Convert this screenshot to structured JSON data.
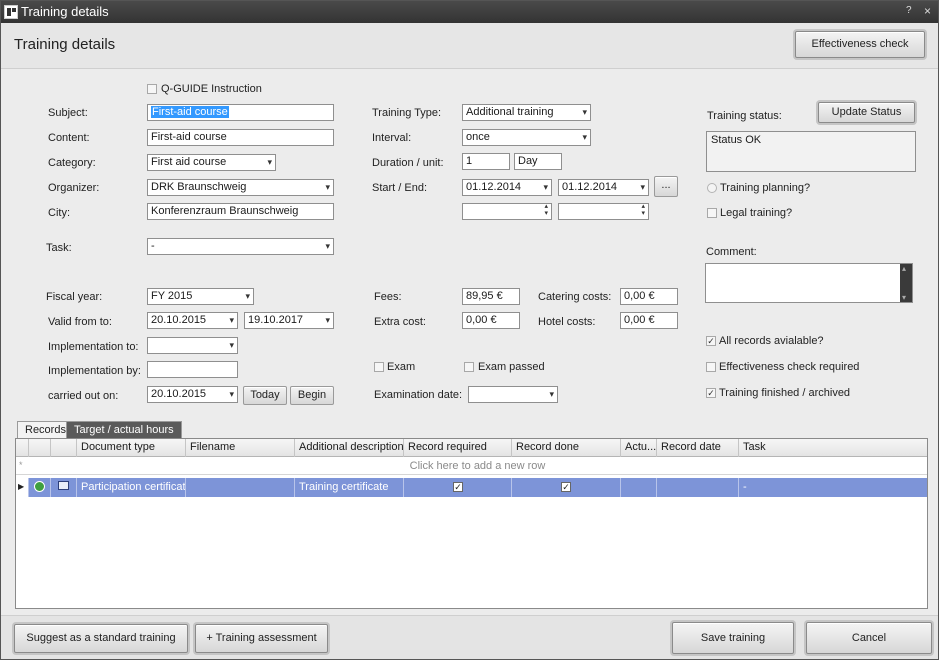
{
  "window": {
    "title": "Training details",
    "help_glyph": "?",
    "close_glyph": "×"
  },
  "header": {
    "page_title": "Training details",
    "effectiveness_check_label": "Effectiveness check"
  },
  "form": {
    "qguide_label": "Q-GUIDE Instruction",
    "subject_label": "Subject:",
    "subject_value": "First-aid course",
    "content_label": "Content:",
    "content_value": "First-aid course",
    "category_label": "Category:",
    "category_value": "First aid course",
    "organizer_label": "Organizer:",
    "organizer_value": "DRK Braunschweig",
    "city_label": "City:",
    "city_value": "Konferenzraum Braunschweig",
    "task_label": "Task:",
    "task_value": "-",
    "fiscal_year_label": "Fiscal year:",
    "fiscal_year_value": "FY 2015",
    "valid_label": "Valid from to:",
    "valid_from": "20.10.2015",
    "valid_to": "19.10.2017",
    "impl_to_label": "Implementation to:",
    "impl_to_value": "",
    "impl_by_label": "Implementation by:",
    "impl_by_value": "",
    "carried_label": "carried out on:",
    "carried_value": "20.10.2015",
    "today_label": "Today",
    "begin_label": "Begin",
    "training_type_label": "Training Type:",
    "training_type_value": "Additional training",
    "interval_label": "Interval:",
    "interval_value": "once",
    "duration_label": "Duration / unit:",
    "duration_value": "1",
    "duration_unit": "Day",
    "start_end_label": "Start / End:",
    "start_value": "01.12.2014",
    "end_value": "01.12.2014",
    "ellipsis_label": "...",
    "start_time": "",
    "end_time": "",
    "fees_label": "Fees:",
    "fees_value": "89,95 €",
    "extra_label": "Extra cost:",
    "extra_value": "0,00 €",
    "catering_label": "Catering costs:",
    "catering_value": "0,00 €",
    "hotel_label": "Hotel costs:",
    "hotel_value": "0,00 €",
    "exam_label": "Exam",
    "exam_passed_label": "Exam passed",
    "exam_date_label": "Examination date:",
    "exam_date_value": "",
    "training_status_label": "Training status:",
    "update_status_label": "Update Status",
    "status_value": "Status OK",
    "training_planning_label": "Training planning?",
    "legal_training_label": "Legal training?",
    "comment_label": "Comment:",
    "all_records_label": "All records avialable?",
    "eff_required_label": "Effectiveness check required",
    "finished_label": "Training finished / archived",
    "check_glyph": "✓"
  },
  "tabs": [
    {
      "label": "Records"
    },
    {
      "label": "Target / actual hours"
    }
  ],
  "grid": {
    "columns": [
      "Document type",
      "Filename",
      "Additional description",
      "Record required",
      "Record done",
      "Actu...",
      "Record date",
      "Task"
    ],
    "new_row_text": "Click here to add a new row",
    "row_indicator": "▶",
    "rows": [
      {
        "document_type": "Participation certificate",
        "filename": "",
        "description": "Training certificate",
        "required": true,
        "done": true,
        "actual": "",
        "record_date": "",
        "task": "-"
      }
    ]
  },
  "footer": {
    "suggest_label": "Suggest as a standard training",
    "assessment_label": "+ Training assessment",
    "save_label": "Save training",
    "cancel_label": "Cancel"
  },
  "colors": {
    "selected_row": "#7d94d8",
    "titlebar": "#3a3a3a",
    "selection_highlight": "#3399ff"
  }
}
